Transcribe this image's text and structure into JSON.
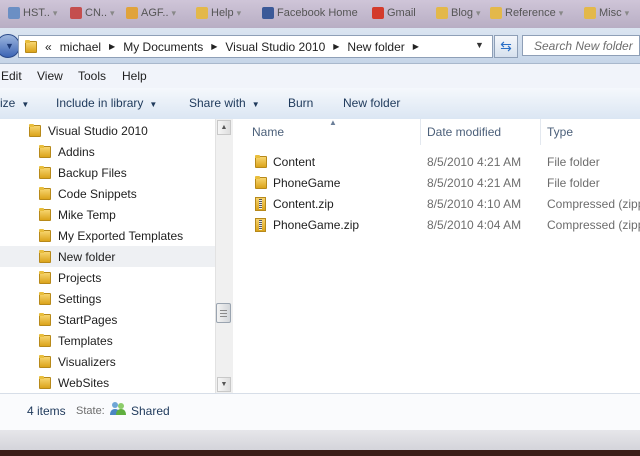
{
  "bookmarks": [
    {
      "label": "HST..",
      "color": "#6b8fc4"
    },
    {
      "label": "CN..",
      "color": "#c44e4e"
    },
    {
      "label": "AGF..",
      "color": "#e0a33b"
    },
    {
      "label": "Help",
      "color": "#e3b84a"
    },
    {
      "label": "Facebook Home",
      "color": "#3b5998"
    },
    {
      "label": "Gmail",
      "color": "#d33b2c"
    },
    {
      "label": "Blog",
      "color": "#e3b84a"
    },
    {
      "label": "Reference",
      "color": "#e3b84a"
    },
    {
      "label": "Misc",
      "color": "#e3b84a"
    }
  ],
  "address": {
    "overflow": "«",
    "crumbs": [
      "michael",
      "My Documents",
      "Visual Studio 2010",
      "New folder"
    ],
    "search_placeholder": "Search New folder"
  },
  "menu": [
    "Edit",
    "View",
    "Tools",
    "Help"
  ],
  "commands": {
    "organize": "ize",
    "include": "Include in library",
    "share": "Share with",
    "burn": "Burn",
    "new_folder": "New folder"
  },
  "nav": {
    "root": "Visual Studio 2010",
    "items": [
      "Addins",
      "Backup Files",
      "Code Snippets",
      "Mike Temp",
      "My Exported Templates",
      "New folder",
      "Projects",
      "Settings",
      "StartPages",
      "Templates",
      "Visualizers",
      "WebSites"
    ],
    "selected_index": 5
  },
  "columns": [
    "Name",
    "Date modified",
    "Type"
  ],
  "files": [
    {
      "name": "Content",
      "date": "8/5/2010 4:21 AM",
      "type": "File folder",
      "icon": "folder"
    },
    {
      "name": "PhoneGame",
      "date": "8/5/2010 4:21 AM",
      "type": "File folder",
      "icon": "folder"
    },
    {
      "name": "Content.zip",
      "date": "8/5/2010 4:10 AM",
      "type": "Compressed (zipp",
      "icon": "zip"
    },
    {
      "name": "PhoneGame.zip",
      "date": "8/5/2010 4:04 AM",
      "type": "Compressed (zipp",
      "icon": "zip"
    }
  ],
  "status": {
    "count": "4 items",
    "state_label": "State:",
    "state_value": "Shared"
  }
}
